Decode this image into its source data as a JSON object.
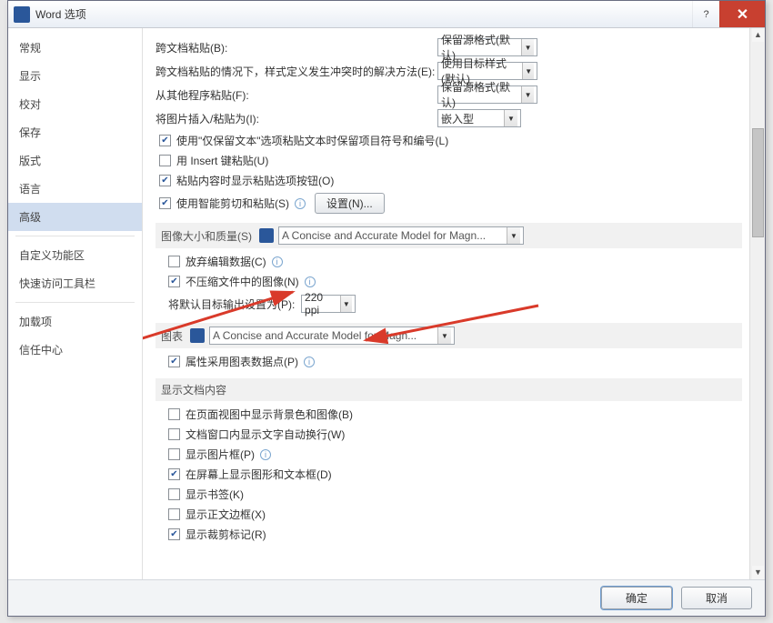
{
  "window": {
    "title": "Word 选项",
    "help": "?",
    "close": "✕"
  },
  "sidebar": {
    "items": [
      {
        "label": "常规"
      },
      {
        "label": "显示"
      },
      {
        "label": "校对"
      },
      {
        "label": "保存"
      },
      {
        "label": "版式"
      },
      {
        "label": "语言"
      },
      {
        "label": "高级",
        "selected": true
      },
      {
        "label": "自定义功能区"
      },
      {
        "label": "快速访问工具栏"
      },
      {
        "label": "加载项"
      },
      {
        "label": "信任中心"
      }
    ]
  },
  "paste": {
    "row1_label": "跨文档粘贴(B):",
    "row1_value": "保留源格式(默认)",
    "row2_label": "跨文档粘贴的情况下，样式定义发生冲突时的解决方法(E):",
    "row2_value": "使用目标样式(默认)",
    "row3_label": "从其他程序粘贴(F):",
    "row3_value": "保留源格式(默认)",
    "row4_label": "将图片插入/粘贴为(I):",
    "row4_value": "嵌入型",
    "chk1": "使用\"仅保留文本\"选项粘贴文本时保留项目符号和编号(L)",
    "chk2": "用 Insert 键粘贴(U)",
    "chk3": "粘贴内容时显示粘贴选项按钮(O)",
    "chk4": "使用智能剪切和粘贴(S)",
    "settings_btn": "设置(N)..."
  },
  "image_section": {
    "title": "图像大小和质量(S)",
    "doc": "A Concise and Accurate Model for Magn...",
    "chk1": "放弃编辑数据(C)",
    "chk2": "不压缩文件中的图像(N)",
    "ppi_label": "将默认目标输出设置为(P):",
    "ppi_value": "220 ppi"
  },
  "chart_section": {
    "title": "图表",
    "doc": "A Concise and Accurate Model for Magn...",
    "chk1": "属性采用图表数据点(P)"
  },
  "display_section": {
    "title": "显示文档内容",
    "chk1": "在页面视图中显示背景色和图像(B)",
    "chk2": "文档窗口内显示文字自动换行(W)",
    "chk3": "显示图片框(P)",
    "chk4": "在屏幕上显示图形和文本框(D)",
    "chk5": "显示书签(K)",
    "chk6": "显示正文边框(X)",
    "chk7": "显示裁剪标记(R)"
  },
  "footer": {
    "ok": "确定",
    "cancel": "取消"
  }
}
